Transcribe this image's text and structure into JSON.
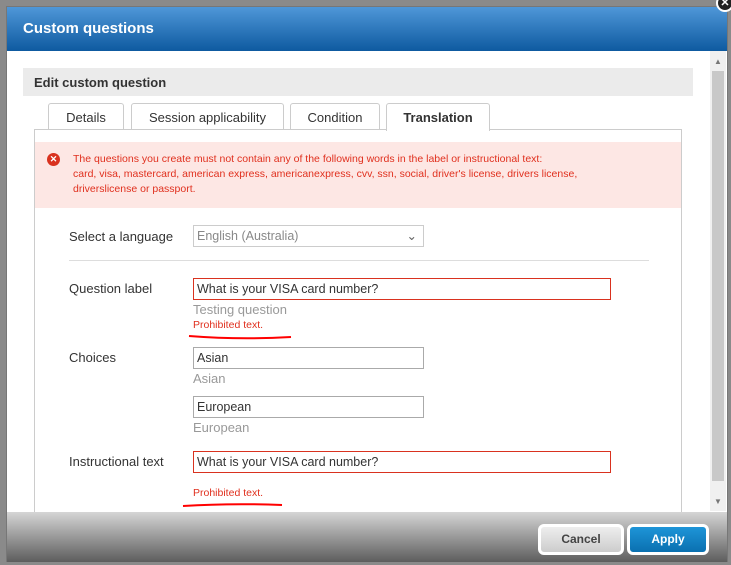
{
  "dialog": {
    "title": "Custom questions",
    "section_title": "Edit custom question"
  },
  "tabs": [
    {
      "label": "Details"
    },
    {
      "label": "Session applicability"
    },
    {
      "label": "Condition"
    },
    {
      "label": "Translation",
      "active": true
    }
  ],
  "error_banner": {
    "line1": "The questions you create must not contain any of the following words in the label or instructional text:",
    "line2": "card, visa, mastercard, american express, americanexpress, cvv, ssn, social, driver's license, drivers license,",
    "line3": "driverslicense or passport."
  },
  "language": {
    "label": "Select a language",
    "value": "English (Australia)"
  },
  "question": {
    "label": "Question label",
    "value": "What is your VISA card number?",
    "original": "Testing question",
    "error": "Prohibited text."
  },
  "choices": {
    "label": "Choices",
    "items": [
      {
        "value": "Asian",
        "original": "Asian"
      },
      {
        "value": "European",
        "original": "European"
      }
    ]
  },
  "instructional": {
    "label": "Instructional text",
    "value": "What is your VISA card number?",
    "error": "Prohibited text."
  },
  "footer": {
    "cancel": "Cancel",
    "apply": "Apply"
  },
  "colors": {
    "header": "#0e5aa0",
    "error": "#e0301e",
    "apply": "#0a7cc1"
  }
}
